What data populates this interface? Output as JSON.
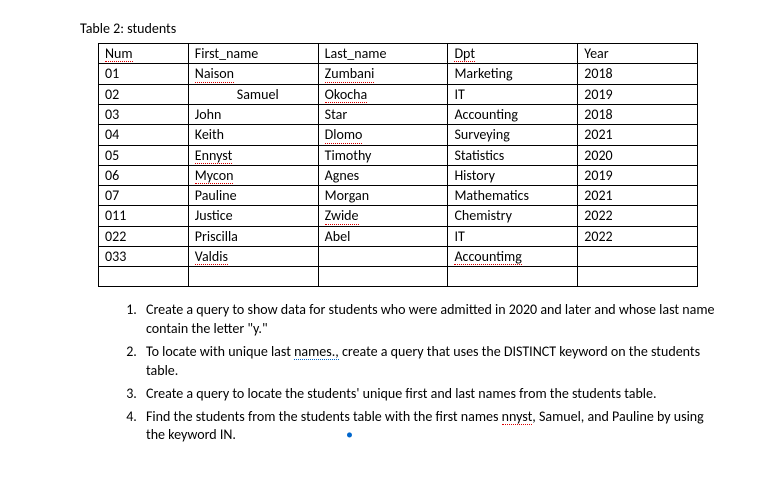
{
  "caption": "Table 2: students",
  "headers": {
    "num": "Num",
    "first": "First_name",
    "last": "Last_name",
    "dpt": "Dpt",
    "year": "Year"
  },
  "rows": [
    {
      "num": "01",
      "first": "Naison",
      "last": "Zumbani",
      "dpt": "Marketing",
      "year": "2018"
    },
    {
      "num": "02",
      "first": "Samuel",
      "last": "Okocha",
      "dpt": "IT",
      "year": "2019"
    },
    {
      "num": "03",
      "first": "John",
      "last": "Star",
      "dpt": "Accounting",
      "year": "2018"
    },
    {
      "num": "04",
      "first": "Keith",
      "last": "Dlomo",
      "dpt": "Surveying",
      "year": "2021"
    },
    {
      "num": "05",
      "first": "Ennyst",
      "last": "Timothy",
      "dpt": "Statistics",
      "year": "2020"
    },
    {
      "num": "06",
      "first": "Mycon",
      "last": "Agnes",
      "dpt": "History",
      "year": "2019"
    },
    {
      "num": "07",
      "first": "Pauline",
      "last": "Morgan",
      "dpt": "Mathematics",
      "year": "2021"
    },
    {
      "num": "011",
      "first": "Justice",
      "last": "Zwide",
      "dpt": "Chemistry",
      "year": "2022"
    },
    {
      "num": "022",
      "first": "Priscilla",
      "last": "Abel",
      "dpt": "IT",
      "year": "2022"
    },
    {
      "num": "033",
      "first": "Valdis",
      "last": "",
      "dpt": "Accountimg",
      "year": ""
    }
  ],
  "chart_data": {
    "type": "table",
    "title": "Table 2: students",
    "columns": [
      "Num",
      "First_name",
      "Last_name",
      "Dpt",
      "Year"
    ],
    "data": [
      [
        "01",
        "Naison",
        "Zumbani",
        "Marketing",
        "2018"
      ],
      [
        "02",
        "Samuel",
        "Okocha",
        "IT",
        "2019"
      ],
      [
        "03",
        "John",
        "Star",
        "Accounting",
        "2018"
      ],
      [
        "04",
        "Keith",
        "Dlomo",
        "Surveying",
        "2021"
      ],
      [
        "05",
        "Ennyst",
        "Timothy",
        "Statistics",
        "2020"
      ],
      [
        "06",
        "Mycon",
        "Agnes",
        "History",
        "2019"
      ],
      [
        "07",
        "Pauline",
        "Morgan",
        "Mathematics",
        "2021"
      ],
      [
        "011",
        "Justice",
        "Zwide",
        "Chemistry",
        "2022"
      ],
      [
        "022",
        "Priscilla",
        "Abel",
        "IT",
        "2022"
      ],
      [
        "033",
        "Valdis",
        "",
        "Accountimg",
        ""
      ]
    ]
  },
  "questions": {
    "q1a": "Create a query to show data for students who were admitted in 2020 and later and whose last name contain the letter \"y.\"",
    "q2a": "To locate with unique last ",
    "q2b": "names.,",
    "q2c": " create a query that uses the DISTINCT keyword on the students table.",
    "q3": "Create a query to locate the students' unique first and last names from the students table.",
    "q4a": "Find the students from the students table with the first names ",
    "q4b": "nnyst",
    "q4c": ", Samuel, and Pauline by using the keyword IN."
  },
  "mark": {
    "red": [
      "Naison",
      "Zumbani",
      "Okocha",
      "Dlomo",
      "Ennyst",
      "Mycon",
      "Zwide",
      "Valdis",
      "Accountimg"
    ],
    "blue": [
      "names.,",
      "nnyst"
    ]
  }
}
